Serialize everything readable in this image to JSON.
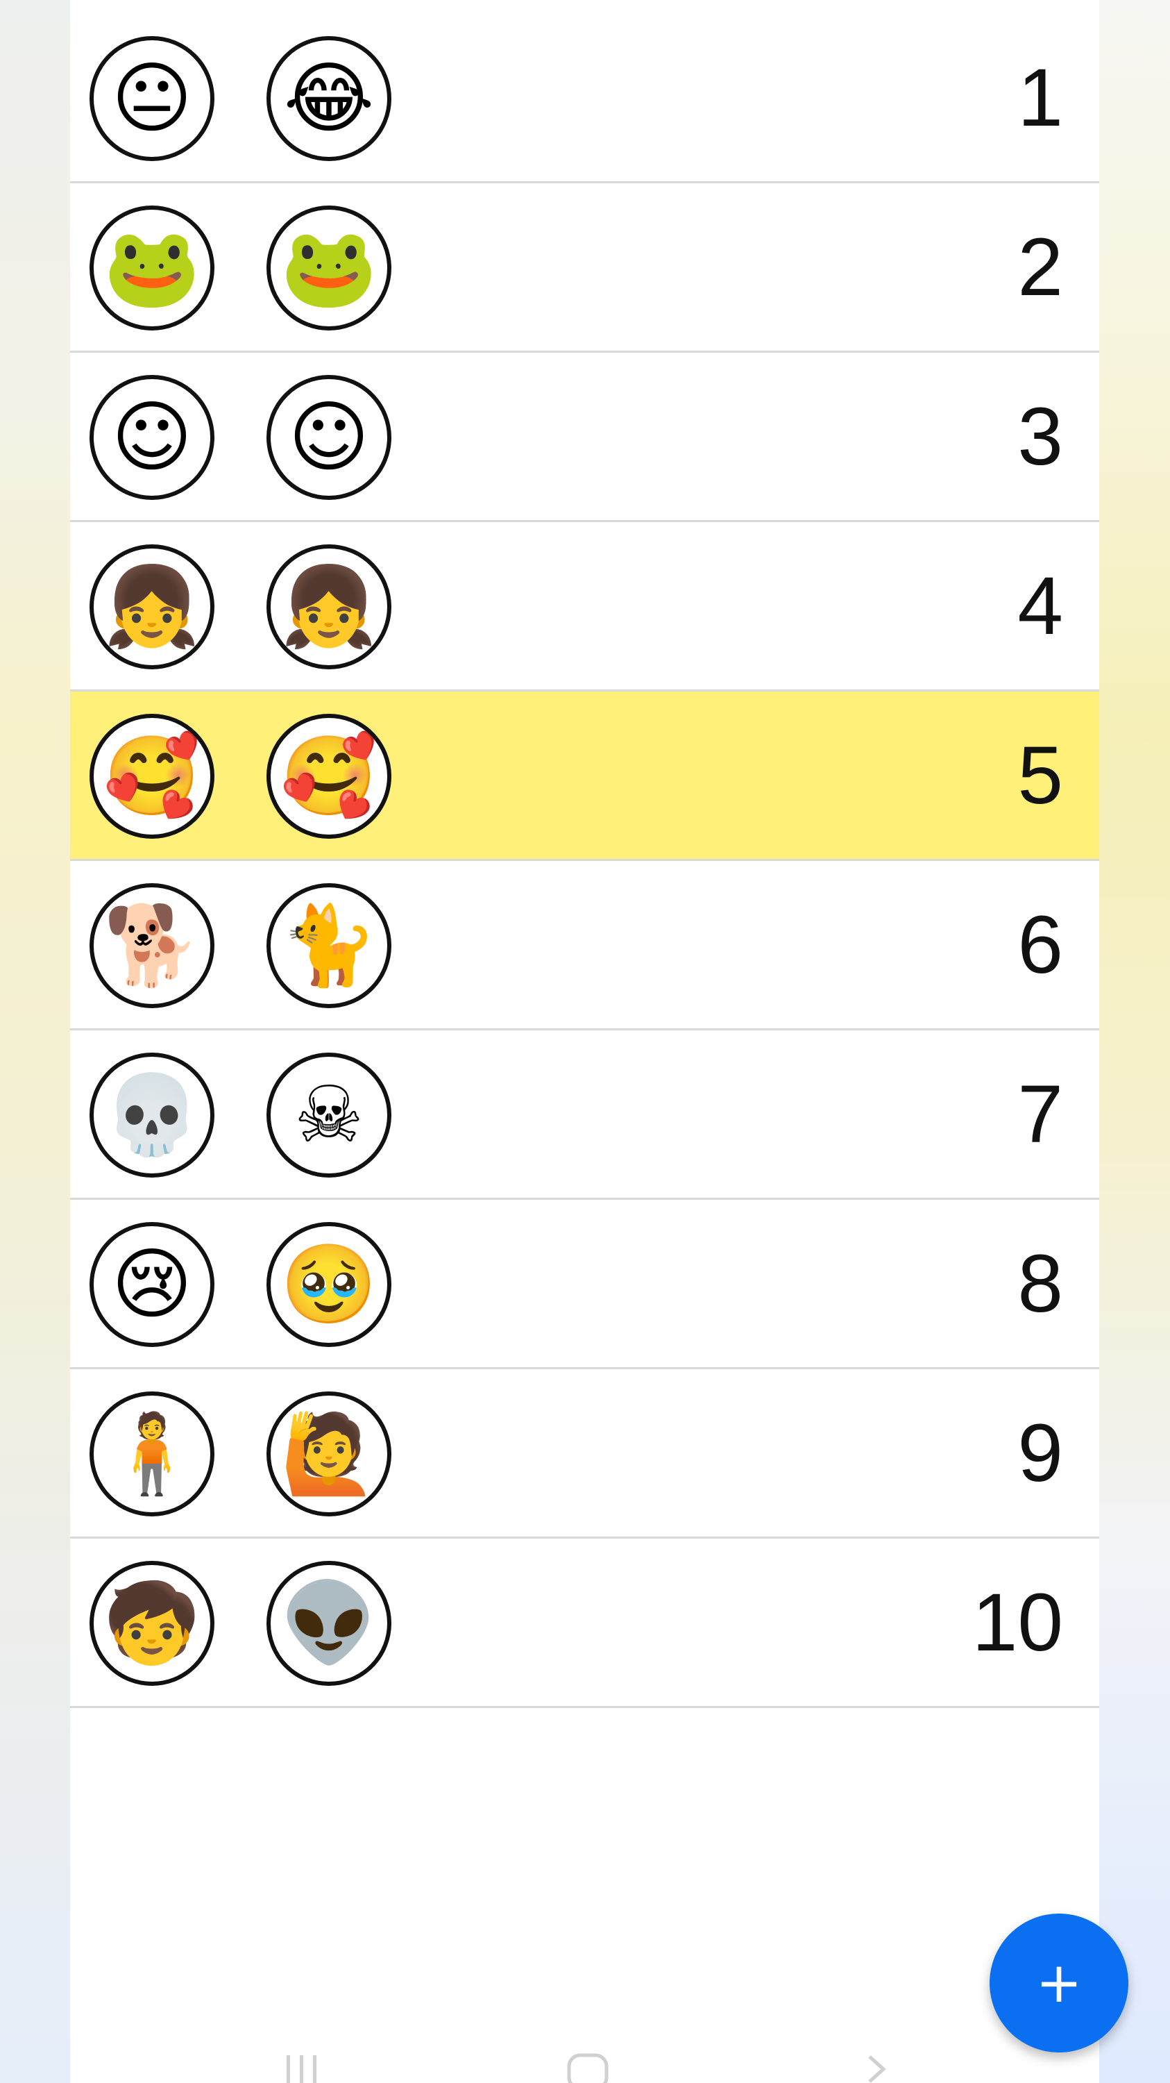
{
  "list": {
    "rows": [
      {
        "number": "1",
        "highlighted": false,
        "left_icon": "neutral-face-icon",
        "left_glyph": "😐",
        "right_icon": "laughing-crying-face-icon",
        "right_glyph": "😂"
      },
      {
        "number": "2",
        "highlighted": false,
        "left_icon": "pepe-frog-icon",
        "left_glyph": "🐸",
        "right_icon": "pepe-frog-thinking-icon",
        "right_glyph": "🐸"
      },
      {
        "number": "3",
        "highlighted": false,
        "left_icon": "lying-blob-icon",
        "left_glyph": "☺",
        "right_icon": "blob-waving-icon",
        "right_glyph": "☺"
      },
      {
        "number": "4",
        "highlighted": false,
        "left_icon": "little-girl-icon",
        "left_glyph": "👧",
        "right_icon": "side-eye-girl-icon",
        "right_glyph": "👧"
      },
      {
        "number": "5",
        "highlighted": true,
        "left_icon": "heart-eyes-hands-icon",
        "left_glyph": "🥰",
        "right_icon": "smiling-hearts-face-icon",
        "right_glyph": "🥰"
      },
      {
        "number": "6",
        "highlighted": false,
        "left_icon": "buff-doge-icon",
        "left_glyph": "🐕",
        "right_icon": "cat-in-suit-icon",
        "right_glyph": "🐈"
      },
      {
        "number": "7",
        "highlighted": false,
        "left_icon": "skull-hat-icon",
        "left_glyph": "💀",
        "right_icon": "skull-sketch-icon",
        "right_glyph": "☠"
      },
      {
        "number": "8",
        "highlighted": false,
        "left_icon": "crying-blob-icon",
        "left_glyph": "😢",
        "right_icon": "teary-hearts-face-icon",
        "right_glyph": "🥹"
      },
      {
        "number": "9",
        "highlighted": false,
        "left_icon": "cartoon-man-icon",
        "left_glyph": "🧍",
        "right_icon": "cartoon-stick-figure-icon",
        "right_glyph": "🙋"
      },
      {
        "number": "10",
        "highlighted": false,
        "left_icon": "curly-hair-kid-icon",
        "left_glyph": "🧒",
        "right_icon": "alien-et-icon",
        "right_glyph": "👽"
      }
    ]
  },
  "fab": {
    "label": "+",
    "icon": "plus-icon",
    "color": "#0a6ff0"
  },
  "colors": {
    "highlight_row": "#fff07a",
    "row_divider": "#d9d9d9",
    "avatar_border": "#111111"
  },
  "navbar": {
    "icons": [
      "recent-apps-icon",
      "home-icon",
      "back-icon"
    ]
  }
}
